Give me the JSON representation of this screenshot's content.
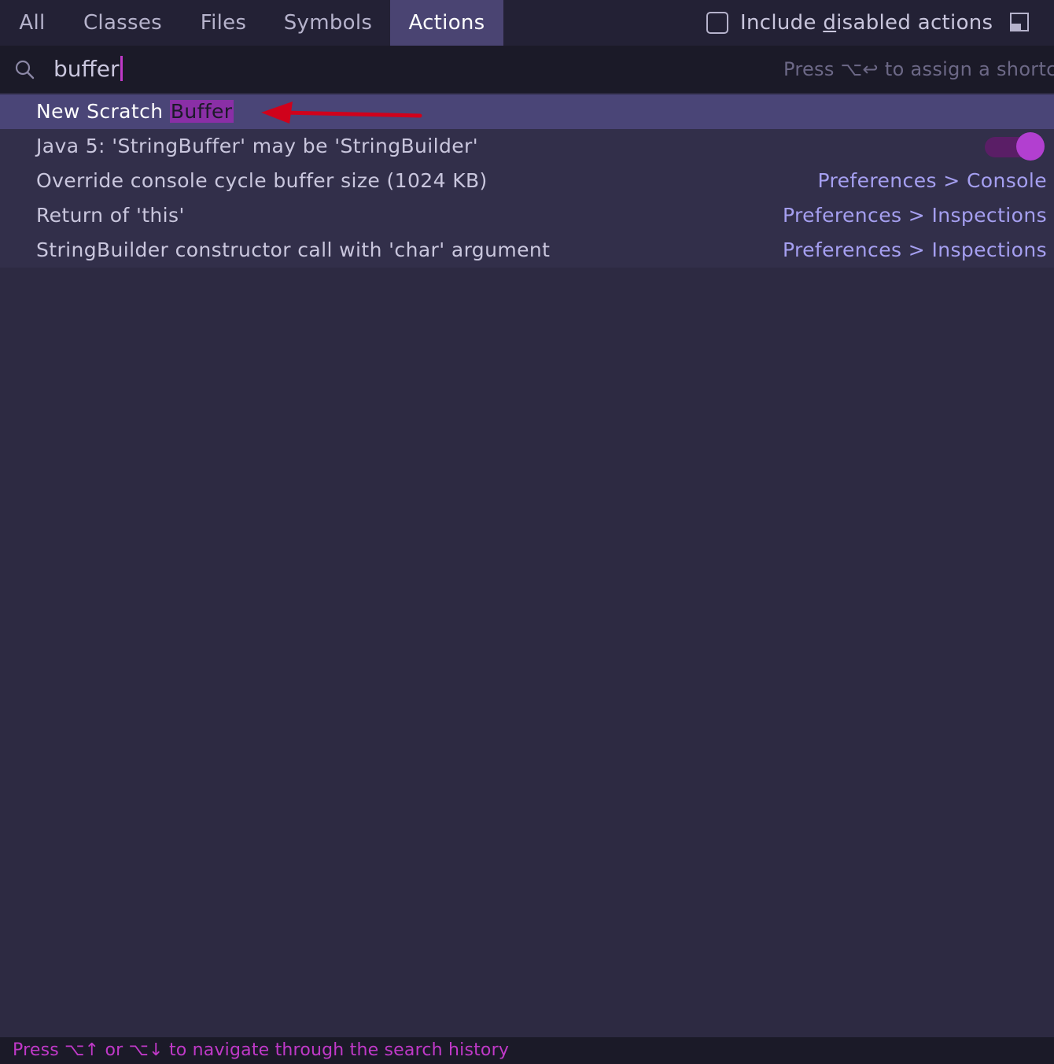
{
  "tabs": [
    {
      "label": "All",
      "active": false
    },
    {
      "label": "Classes",
      "active": false
    },
    {
      "label": "Files",
      "active": false
    },
    {
      "label": "Symbols",
      "active": false
    },
    {
      "label": "Actions",
      "active": true
    }
  ],
  "include_disabled": {
    "prefix": "Include ",
    "mnemonic": "d",
    "suffix": "isabled actions",
    "checked": false
  },
  "search": {
    "value": "buffer",
    "hint": "Press ⌥↩ to assign a shortcu"
  },
  "results": [
    {
      "label_prefix": "New Scratch ",
      "label_match": "Buffer",
      "selected": true,
      "right": ""
    },
    {
      "label_prefix": "Java 5: 'StringBuffer' may be 'StringBuilder'",
      "label_match": "",
      "selected": false,
      "right": "",
      "toggle_on": true
    },
    {
      "label_prefix": "Override console cycle buffer size (1024 KB)",
      "label_match": "",
      "selected": false,
      "right": "Preferences > Console"
    },
    {
      "label_prefix": "Return of 'this'",
      "label_match": "",
      "selected": false,
      "right": "Preferences > Inspections"
    },
    {
      "label_prefix": "StringBuilder constructor call with 'char' argument",
      "label_match": "",
      "selected": false,
      "right": "Preferences > Inspections"
    }
  ],
  "status": {
    "text": "Press ⌥↑ or ⌥↓ to navigate through the search history"
  },
  "colors": {
    "accent": "#c039c8",
    "highlight": "#8a2fa6",
    "selected_row": "#4a4577",
    "annotation_arrow": "#d0021b"
  }
}
